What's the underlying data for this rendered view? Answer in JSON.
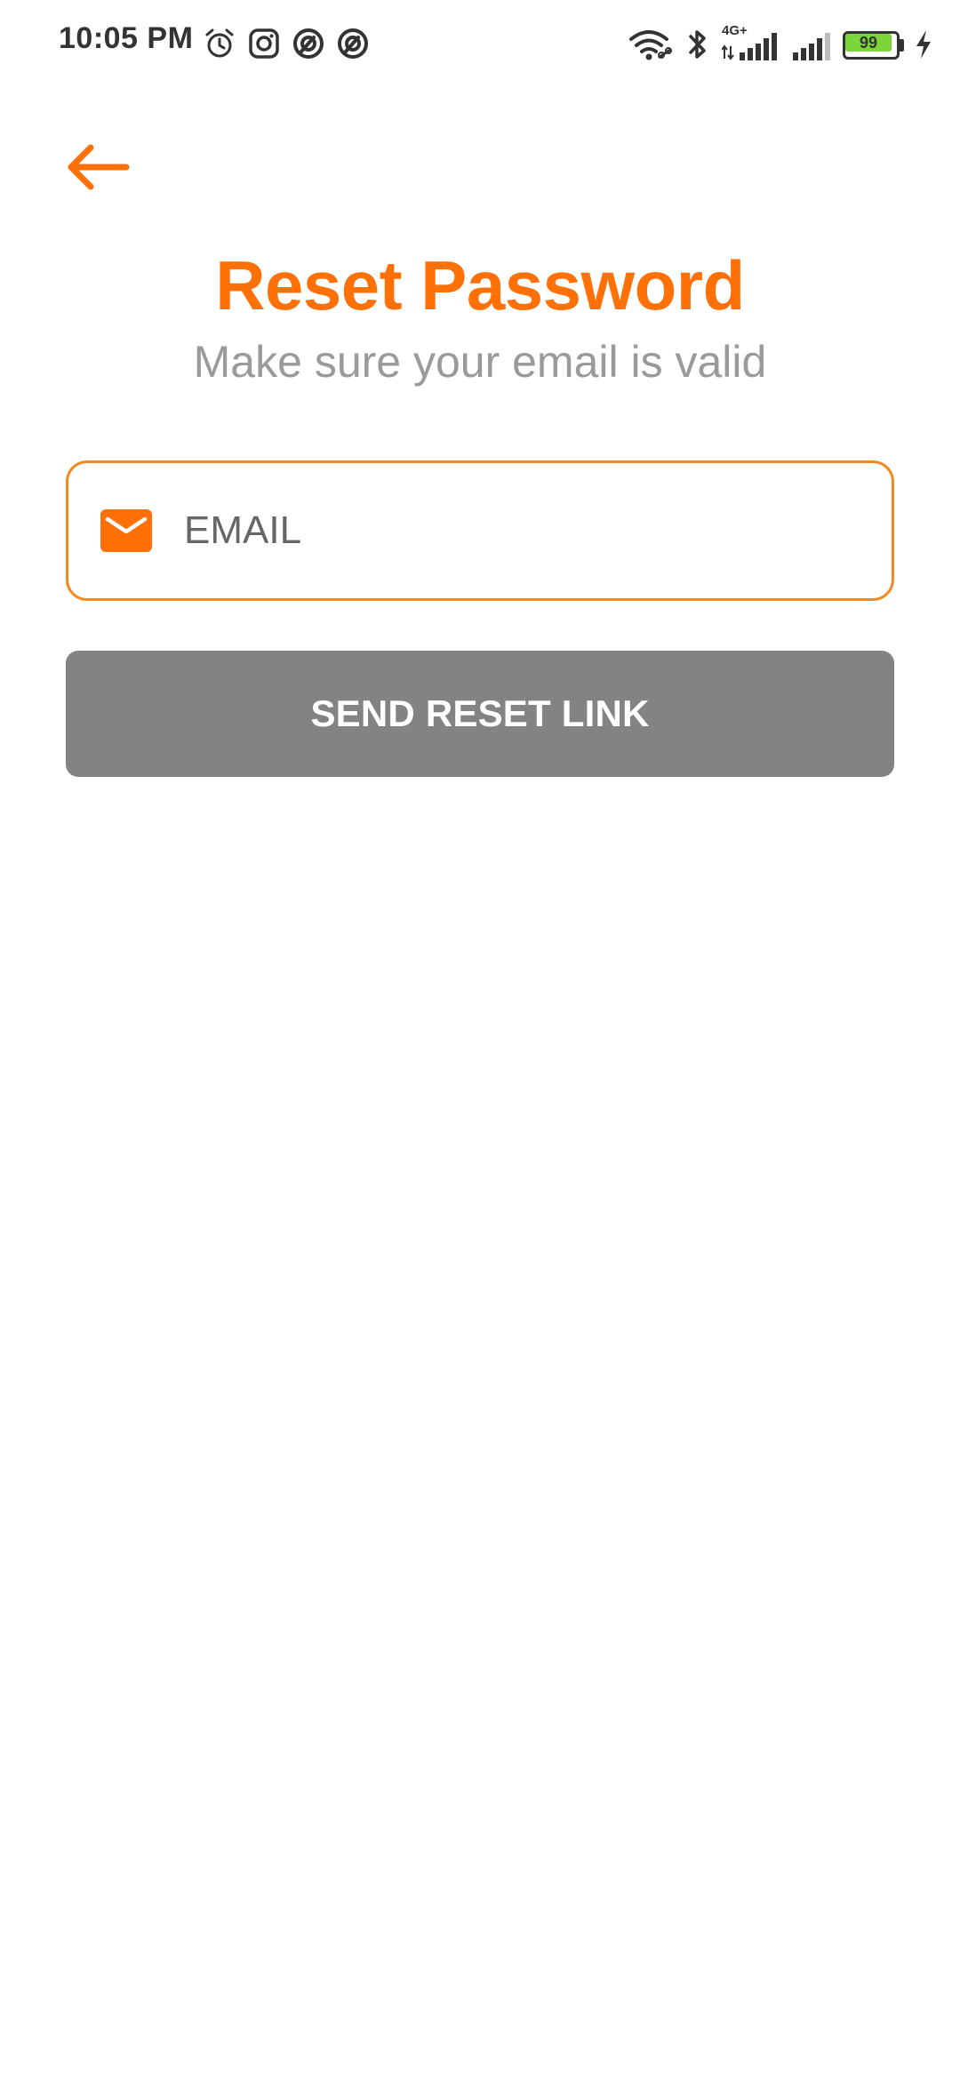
{
  "status_bar": {
    "time": "10:05 PM",
    "network": "4G+",
    "battery": "99",
    "left_icons": [
      "alarm-icon",
      "instagram-icon",
      "app-notification-icon",
      "app-notification-icon"
    ],
    "right_icons": [
      "wifi-icon",
      "bluetooth-icon",
      "signal-icon",
      "signal-icon",
      "battery-icon",
      "charging-icon"
    ]
  },
  "header": {
    "back_icon": "arrow-left-icon",
    "title": "Reset Password",
    "subtitle": "Make sure your email is valid"
  },
  "form": {
    "email_icon": "mail-icon",
    "email_placeholder": "EMAIL",
    "email_value": "",
    "submit_label": "SEND RESET LINK"
  },
  "colors": {
    "accent": "#ff7007",
    "field_border": "#f08a24",
    "button_bg": "#838383",
    "subtitle": "#9a9a9a"
  }
}
